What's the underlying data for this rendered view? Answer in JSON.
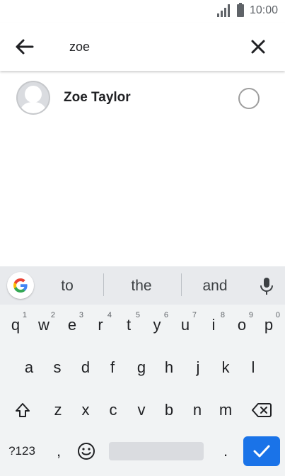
{
  "status_bar": {
    "time": "10:00"
  },
  "search": {
    "query": "zoe"
  },
  "results": [
    {
      "name": "Zoe Taylor",
      "selected": false
    }
  ],
  "keyboard": {
    "suggestions": [
      "to",
      "the",
      "and"
    ],
    "row1": [
      {
        "key": "q",
        "hint": "1"
      },
      {
        "key": "w",
        "hint": "2"
      },
      {
        "key": "e",
        "hint": "3"
      },
      {
        "key": "r",
        "hint": "4"
      },
      {
        "key": "t",
        "hint": "5"
      },
      {
        "key": "y",
        "hint": "6"
      },
      {
        "key": "u",
        "hint": "7"
      },
      {
        "key": "i",
        "hint": "8"
      },
      {
        "key": "o",
        "hint": "9"
      },
      {
        "key": "p",
        "hint": "0"
      }
    ],
    "row2": [
      "a",
      "s",
      "d",
      "f",
      "g",
      "h",
      "j",
      "k",
      "l"
    ],
    "row3": [
      "z",
      "x",
      "c",
      "v",
      "b",
      "n",
      "m"
    ],
    "symbols_label": "?123",
    "comma": ",",
    "period": ".",
    "icons": {
      "google": "google-g-icon",
      "mic": "microphone-icon",
      "shift": "shift-icon",
      "backspace": "backspace-icon",
      "emoji": "emoji-icon",
      "enter": "checkmark-icon"
    }
  },
  "colors": {
    "accent": "#1a73e8",
    "keyboard_bg": "#f1f3f4",
    "suggestion_bg": "#e8eaed"
  }
}
